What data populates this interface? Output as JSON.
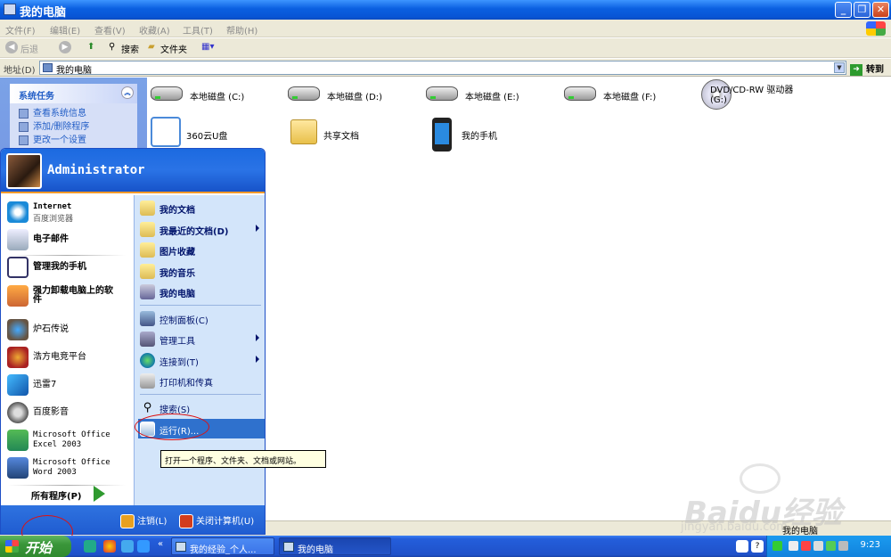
{
  "window": {
    "title": "我的电脑",
    "menu": [
      "文件(F)",
      "编辑(E)",
      "查看(V)",
      "收藏(A)",
      "工具(T)",
      "帮助(H)"
    ],
    "toolbar": {
      "back": "后退",
      "search": "搜索",
      "folders": "文件夹"
    },
    "address": {
      "label": "地址(D)",
      "value": "我的电脑",
      "go": "转到"
    }
  },
  "tasks": {
    "title": "系统任务",
    "links": [
      "查看系统信息",
      "添加/删除程序",
      "更改一个设置"
    ]
  },
  "drives": [
    {
      "label": "本地磁盘 (C:)"
    },
    {
      "label": "本地磁盘 (D:)"
    },
    {
      "label": "本地磁盘 (E:)"
    },
    {
      "label": "本地磁盘 (F:)"
    }
  ],
  "dvd": {
    "line1": "DVD/CD-RW 驱动器",
    "line2": "(G:)"
  },
  "items": {
    "usb": "360云U盘",
    "shared": "共享文档",
    "phone": "我的手机"
  },
  "start_menu": {
    "user": "Administrator",
    "pinned": [
      {
        "title": "Internet",
        "subtitle": "百度浏览器"
      },
      {
        "title": "电子邮件",
        "subtitle": ""
      }
    ],
    "recent": [
      {
        "title": "管理我的手机",
        "subtitle": ""
      },
      {
        "title": "强力卸载电脑上的软",
        "subtitle": "件"
      },
      {
        "title": "炉石传说",
        "subtitle": ""
      },
      {
        "title": "浩方电竞平台",
        "subtitle": ""
      },
      {
        "title": "迅雷7",
        "subtitle": ""
      },
      {
        "title": "百度影音",
        "subtitle": ""
      },
      {
        "title": "Microsoft Office",
        "subtitle": "Excel 2003"
      },
      {
        "title": "Microsoft Office",
        "subtitle": "Word 2003"
      }
    ],
    "all_programs": "所有程序(P)",
    "right": [
      {
        "label": "我的文档"
      },
      {
        "label": "我最近的文档(D)"
      },
      {
        "label": "图片收藏"
      },
      {
        "label": "我的音乐"
      },
      {
        "label": "我的电脑"
      },
      {
        "label": "控制面板(C)"
      },
      {
        "label": "管理工具"
      },
      {
        "label": "连接到(T)"
      },
      {
        "label": "打印机和传真"
      },
      {
        "label": "搜索(S)"
      },
      {
        "label": "运行(R)..."
      }
    ],
    "logoff": "注销(L)",
    "shutdown": "关闭计算机(U)"
  },
  "tooltip": "打开一个程序、文件夹、文档或网站。",
  "statusbar": {
    "text": "我的电脑"
  },
  "taskbar": {
    "start": "开始",
    "buttons": [
      "我的经验_个人...",
      "我的电脑"
    ],
    "clock": "9:23"
  },
  "watermark": {
    "brand": "Baidu经验",
    "url": "jingyan.baidu.com"
  },
  "colors": {
    "xp_blue": "#245edb",
    "start_green": "#3a963a",
    "highlight": "#2f71cd",
    "annotation_red": "#d11111"
  }
}
